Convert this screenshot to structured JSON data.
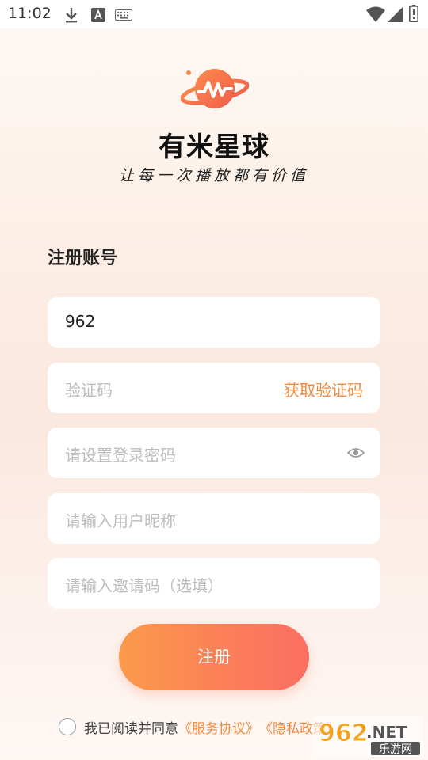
{
  "status_bar": {
    "time": "11:02",
    "icons": [
      "download-icon",
      "a-box-icon",
      "keyboard-icon",
      "wifi-icon",
      "signal-icon",
      "battery-icon"
    ]
  },
  "app": {
    "name": "有米星球",
    "slogan": "让每一次播放都有价值",
    "logo": "planet-logo"
  },
  "form": {
    "title": "注册账号",
    "phone_value": "962",
    "code_placeholder": "验证码",
    "get_code_label": "获取验证码",
    "password_placeholder": "请设置登录密码",
    "nickname_placeholder": "请输入用户昵称",
    "invite_placeholder": "请输入邀请码（选填）",
    "submit_label": "注册"
  },
  "agreement": {
    "prefix": "我已阅读并同意",
    "service_link": "《服务协议》",
    "privacy_link": "《隐私政策》"
  },
  "watermark": {
    "brand": "962",
    "suffix": ".NET",
    "subtitle": "乐游网"
  },
  "colors": {
    "accent": "#f08a3e",
    "button_start": "#fb9a4b",
    "button_end": "#fb6f62"
  }
}
